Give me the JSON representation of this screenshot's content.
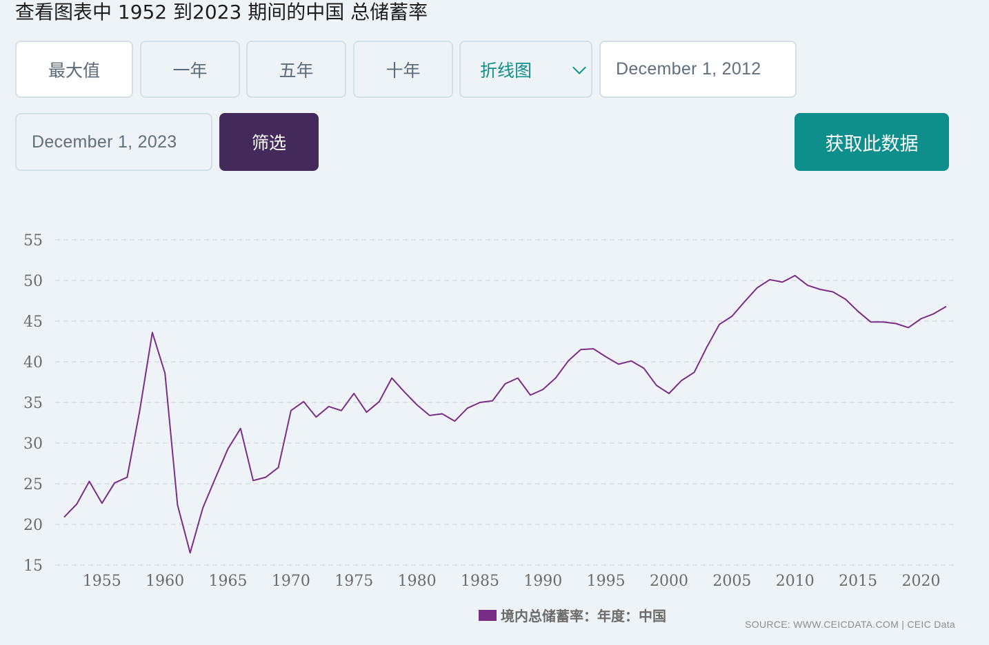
{
  "title": "查看图表中 1952 到2023 期间的中国 总储蓄率",
  "controls": {
    "max_label": "最大值",
    "one_year_label": "一年",
    "five_year_label": "五年",
    "ten_year_label": "十年",
    "chart_type_label": "折线图",
    "start_date": "December 1, 2012",
    "end_date": "December 1, 2023",
    "filter_label": "筛选",
    "get_data_label": "获取此数据"
  },
  "colors": {
    "line": "#7a2d86",
    "accent": "#0f8f8c",
    "filter_button": "#432a5b"
  },
  "legend": {
    "label": "境内总储蓄率：年度：中国"
  },
  "source": {
    "text": "SOURCE: WWW.CEICDATA.COM | CEIC Data"
  },
  "chart_data": {
    "type": "line",
    "title": "",
    "xlabel": "",
    "ylabel": "",
    "xlim": [
      1952,
      2022
    ],
    "ylim": [
      15,
      55
    ],
    "y_ticks": [
      15,
      20,
      25,
      30,
      35,
      40,
      45,
      50,
      55
    ],
    "x_ticks": [
      1955,
      1960,
      1965,
      1970,
      1975,
      1980,
      1985,
      1990,
      1995,
      2000,
      2005,
      2010,
      2015,
      2020
    ],
    "grid": "horizontal dashed",
    "legend_position": "bottom-center",
    "series": [
      {
        "name": "境内总储蓄率：年度：中国",
        "x": [
          1952,
          1953,
          1954,
          1955,
          1956,
          1957,
          1958,
          1959,
          1960,
          1961,
          1962,
          1963,
          1964,
          1965,
          1966,
          1967,
          1968,
          1969,
          1970,
          1971,
          1972,
          1973,
          1974,
          1975,
          1976,
          1977,
          1978,
          1979,
          1980,
          1981,
          1982,
          1983,
          1984,
          1985,
          1986,
          1987,
          1988,
          1989,
          1990,
          1991,
          1992,
          1993,
          1994,
          1995,
          1996,
          1997,
          1998,
          1999,
          2000,
          2001,
          2002,
          2003,
          2004,
          2005,
          2006,
          2007,
          2008,
          2009,
          2010,
          2011,
          2012,
          2013,
          2014,
          2015,
          2016,
          2017,
          2018,
          2019,
          2020,
          2021,
          2022
        ],
        "values": [
          20.9,
          22.5,
          25.3,
          22.6,
          25.1,
          25.8,
          34.0,
          43.6,
          38.6,
          22.4,
          16.5,
          22.0,
          25.7,
          29.3,
          31.8,
          25.4,
          25.8,
          27.0,
          34.0,
          35.1,
          33.2,
          34.5,
          34.0,
          36.1,
          33.8,
          35.1,
          38.0,
          36.3,
          34.7,
          33.4,
          33.6,
          32.7,
          34.3,
          35.0,
          35.2,
          37.3,
          38.0,
          35.9,
          36.6,
          38.0,
          40.1,
          41.5,
          41.6,
          40.6,
          39.7,
          40.1,
          39.2,
          37.1,
          36.1,
          37.7,
          38.7,
          41.8,
          44.6,
          45.6,
          47.4,
          49.1,
          50.1,
          49.8,
          50.6,
          49.4,
          48.9,
          48.6,
          47.7,
          46.2,
          44.9,
          44.9,
          44.7,
          44.2,
          45.3,
          45.9,
          46.8
        ]
      }
    ]
  }
}
